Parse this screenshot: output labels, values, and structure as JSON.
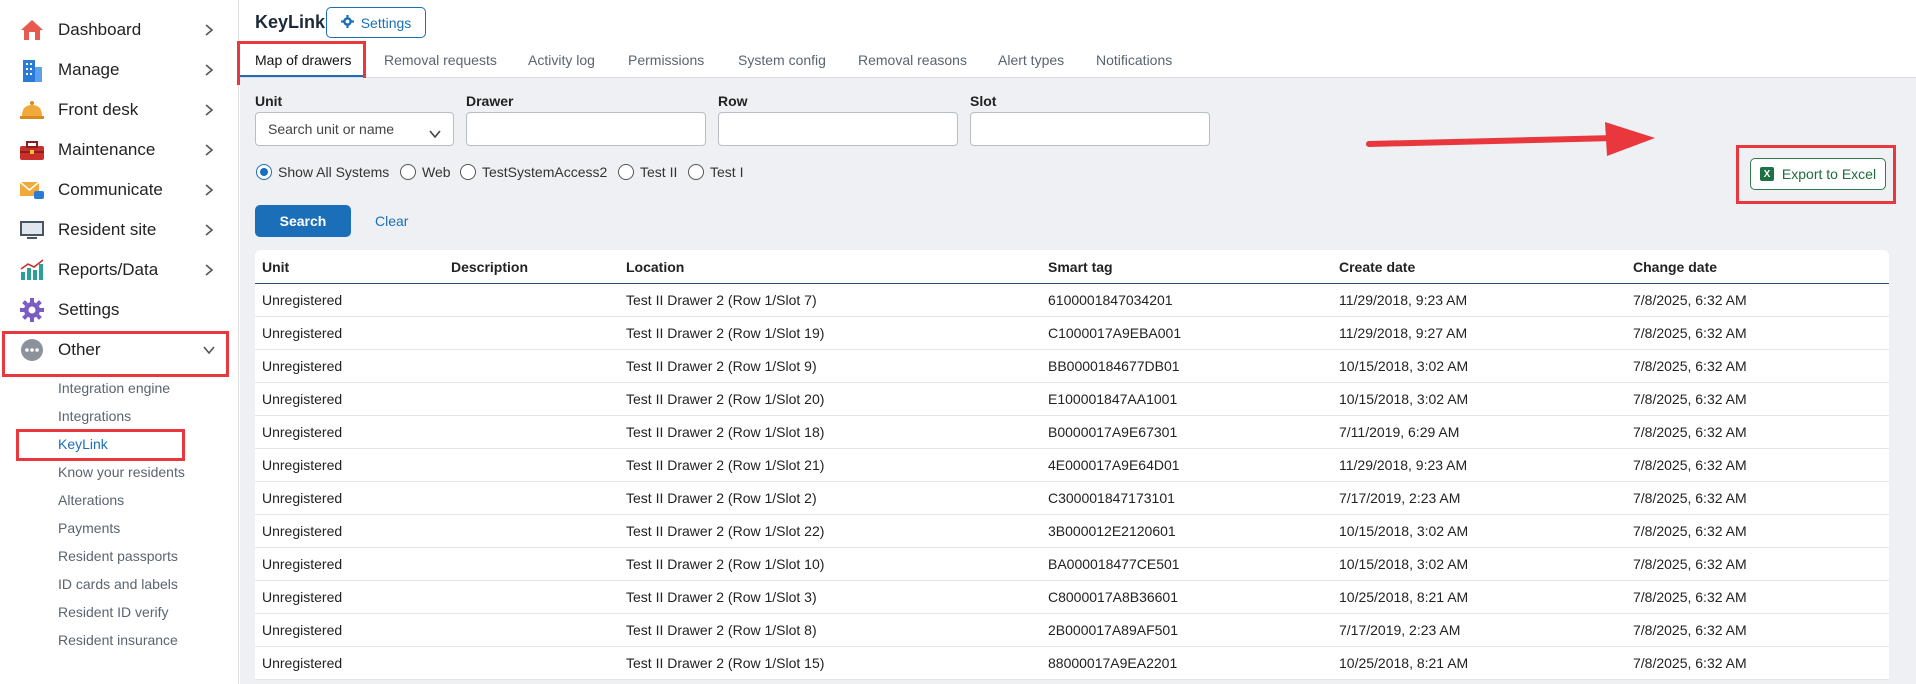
{
  "sidebar": {
    "items": [
      {
        "label": "Dashboard",
        "icon": "house-icon"
      },
      {
        "label": "Manage",
        "icon": "building-icon"
      },
      {
        "label": "Front desk",
        "icon": "bell-icon"
      },
      {
        "label": "Maintenance",
        "icon": "toolbox-icon"
      },
      {
        "label": "Communicate",
        "icon": "envelope-icon"
      },
      {
        "label": "Resident site",
        "icon": "monitor-icon"
      },
      {
        "label": "Reports/Data",
        "icon": "chart-icon"
      },
      {
        "label": "Settings",
        "icon": "gear-icon"
      },
      {
        "label": "Other",
        "icon": "more-icon"
      }
    ],
    "other_subitems": [
      "Integration engine",
      "Integrations",
      "KeyLink",
      "Know your residents",
      "Alterations",
      "Payments",
      "Resident passports",
      "ID cards and labels",
      "Resident ID verify",
      "Resident insurance"
    ]
  },
  "header": {
    "title": "KeyLink",
    "settings_label": "Settings",
    "tabs": [
      "Map of drawers",
      "Removal requests",
      "Activity log",
      "Permissions",
      "System config",
      "Removal reasons",
      "Alert types",
      "Notifications"
    ]
  },
  "filters": {
    "unit_label": "Unit",
    "unit_placeholder": "Search unit or name",
    "drawer_label": "Drawer",
    "row_label": "Row",
    "slot_label": "Slot",
    "systems": [
      "Show All Systems",
      "Web",
      "TestSystemAccess2",
      "Test II",
      "Test I"
    ],
    "selected_system": "Show All Systems",
    "search_label": "Search",
    "clear_label": "Clear",
    "export_label": "Export to Excel"
  },
  "table": {
    "headers": [
      "Unit",
      "Description",
      "Location",
      "Smart tag",
      "Create date",
      "Change date"
    ],
    "rows": [
      [
        "Unregistered",
        "",
        "Test II Drawer 2 (Row 1/Slot 7)",
        "6100001847034201",
        "11/29/2018, 9:23 AM",
        "7/8/2025, 6:32 AM"
      ],
      [
        "Unregistered",
        "",
        "Test II Drawer 2 (Row 1/Slot 19)",
        "C1000017A9EBA001",
        "11/29/2018, 9:27 AM",
        "7/8/2025, 6:32 AM"
      ],
      [
        "Unregistered",
        "",
        "Test II Drawer 2 (Row 1/Slot 9)",
        "BB0000184677DB01",
        "10/15/2018, 3:02 AM",
        "7/8/2025, 6:32 AM"
      ],
      [
        "Unregistered",
        "",
        "Test II Drawer 2 (Row 1/Slot 20)",
        "E100001847AA1001",
        "10/15/2018, 3:02 AM",
        "7/8/2025, 6:32 AM"
      ],
      [
        "Unregistered",
        "",
        "Test II Drawer 2 (Row 1/Slot 18)",
        "B0000017A9E67301",
        "7/11/2019, 6:29 AM",
        "7/8/2025, 6:32 AM"
      ],
      [
        "Unregistered",
        "",
        "Test II Drawer 2 (Row 1/Slot 21)",
        "4E000017A9E64D01",
        "11/29/2018, 9:23 AM",
        "7/8/2025, 6:32 AM"
      ],
      [
        "Unregistered",
        "",
        "Test II Drawer 2 (Row 1/Slot 2)",
        "C300001847173101",
        "7/17/2019, 2:23 AM",
        "7/8/2025, 6:32 AM"
      ],
      [
        "Unregistered",
        "",
        "Test II Drawer 2 (Row 1/Slot 22)",
        "3B000012E2120601",
        "10/15/2018, 3:02 AM",
        "7/8/2025, 6:32 AM"
      ],
      [
        "Unregistered",
        "",
        "Test II Drawer 2 (Row 1/Slot 10)",
        "BA000018477CE501",
        "10/15/2018, 3:02 AM",
        "7/8/2025, 6:32 AM"
      ],
      [
        "Unregistered",
        "",
        "Test II Drawer 2 (Row 1/Slot 3)",
        "C8000017A8B36601",
        "10/25/2018, 8:21 AM",
        "7/8/2025, 6:32 AM"
      ],
      [
        "Unregistered",
        "",
        "Test II Drawer 2 (Row 1/Slot 8)",
        "2B000017A89AF501",
        "7/17/2019, 2:23 AM",
        "7/8/2025, 6:32 AM"
      ],
      [
        "Unregistered",
        "",
        "Test II Drawer 2 (Row 1/Slot 15)",
        "88000017A9EA2201",
        "10/25/2018, 8:21 AM",
        "7/8/2025, 6:32 AM"
      ]
    ]
  },
  "colors": {
    "accent": "#1a6fb8",
    "highlight": "#e8383d",
    "excel_green": "#1e7145"
  }
}
